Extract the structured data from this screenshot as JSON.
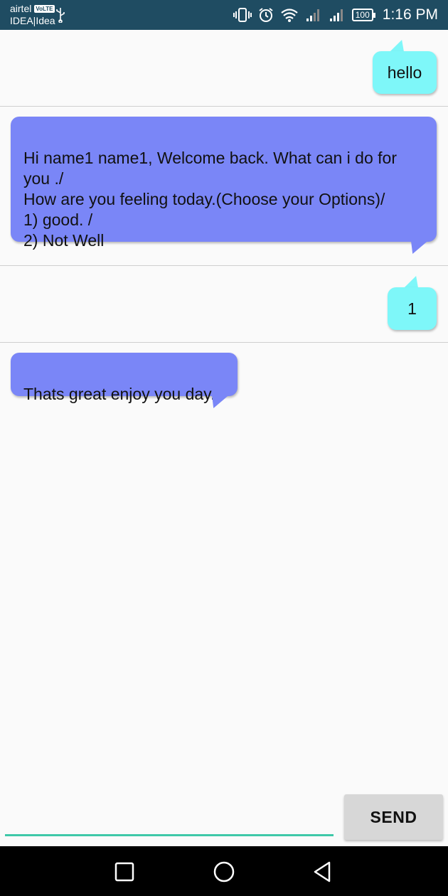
{
  "status_bar": {
    "carrier_primary": "airtel",
    "volte_badge": "VoLTE",
    "carrier_secondary": "IDEA|Idea",
    "battery": "100",
    "time": "1:16 PM",
    "icons": [
      "usb-icon",
      "vibrate-icon",
      "alarm-icon",
      "wifi-icon",
      "signal-icon",
      "signal-icon",
      "battery-icon"
    ]
  },
  "messages": [
    {
      "sender": "user",
      "text": "hello"
    },
    {
      "sender": "bot",
      "text": "Hi name1  name1, Welcome back. What can i do for you ./\nHow are you feeling today.(Choose your Options)/\n 1) good. /\n 2) Not Well"
    },
    {
      "sender": "user",
      "text": "1"
    },
    {
      "sender": "bot",
      "text": "Thats great enjoy you day."
    }
  ],
  "composer": {
    "input_value": "",
    "send_label": "SEND",
    "accent": "#3ec8a8"
  },
  "colors": {
    "status_bar": "#1f4c62",
    "user_bubble": "#7ef7f9",
    "bot_bubble": "#7a86f7"
  },
  "nav_bar": {
    "buttons": [
      "recent-apps-icon",
      "home-icon",
      "back-icon"
    ]
  }
}
